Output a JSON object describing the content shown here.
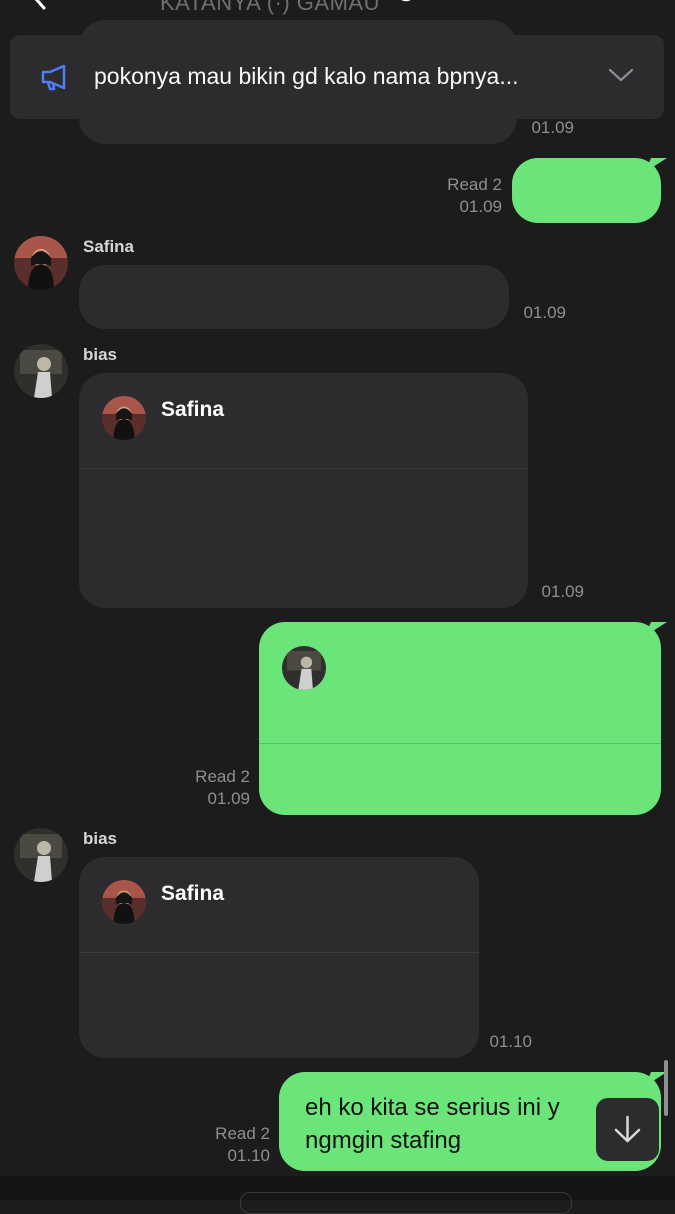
{
  "header": {
    "title": "KATANYA (·) GAMAU"
  },
  "pinned_announcement": {
    "text": "pokonya mau bikin gd kalo nama bpnya..."
  },
  "messages": [
    {
      "time": "01.09"
    },
    {
      "read": "Read 2",
      "time": "01.09"
    },
    {
      "sender": "Safina",
      "time": "01.09"
    },
    {
      "sender": "bias",
      "quote_name": "Safina",
      "time": "01.09"
    },
    {
      "read": "Read 2",
      "time": "01.09"
    },
    {
      "sender": "bias",
      "quote_name": "Safina",
      "time": "01.10"
    },
    {
      "read": "Read 2",
      "time": "01.10",
      "text": "eh ko kita se serius ini y\nngmgin stafing"
    }
  ],
  "colors": {
    "background": "#1c1c1d",
    "incoming_bubble": "#2c2c2e",
    "outgoing_bubble": "#6be57a",
    "meta_text": "#8e8e93",
    "announce_icon": "#4f7cff"
  },
  "icons": {
    "announcement": "megaphone-icon",
    "chevron": "chevron-down-icon",
    "scroll_down": "arrow-down-icon"
  }
}
